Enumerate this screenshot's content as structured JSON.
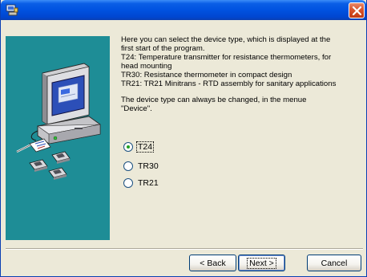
{
  "window": {
    "title_icon": "setup-app-icon",
    "close_icon": "close-icon"
  },
  "sidebar": {
    "illustration": "computer-setup-illustration"
  },
  "description": {
    "line1": "Here you can select the device type, which is displayed at the",
    "line2": "first start of the program.",
    "line3": "T24: Temperature transmitter for resistance thermometers, for",
    "line4": "head mounting",
    "line5": "TR30: Resistance thermometer in compact design",
    "line6": "TR21:  TR21 Minitrans - RTD assembly for sanitary applications",
    "line7": "The device type can always be changed, in the menue",
    "line8": "\"Device\"."
  },
  "device_options": [
    {
      "label": "T24",
      "selected": true
    },
    {
      "label": "TR30",
      "selected": false
    },
    {
      "label": "TR21",
      "selected": false
    }
  ],
  "buttons": {
    "back_label": "< Back",
    "next_label": "Next >",
    "cancel_label": "Cancel"
  },
  "colors": {
    "title_bar": "#0052e0",
    "dialog_bg": "#ece9d8",
    "side_panel": "#1e8d96",
    "radio_dot": "#21a121"
  }
}
